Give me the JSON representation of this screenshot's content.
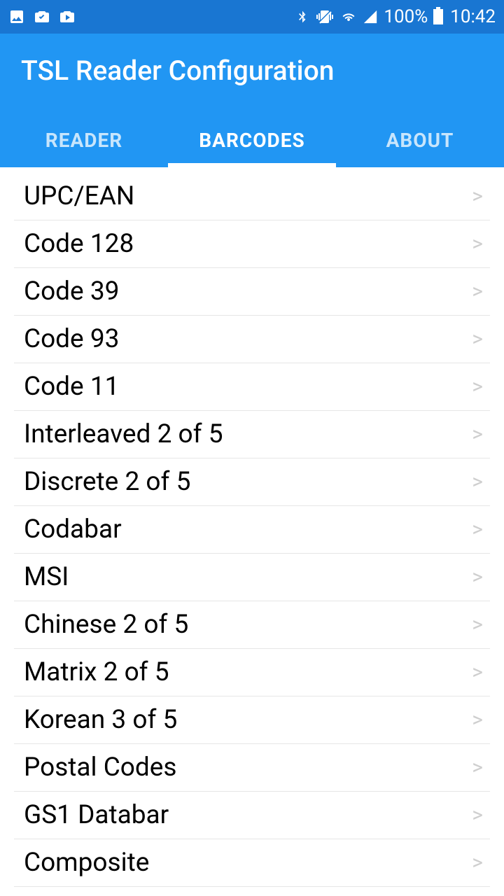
{
  "status": {
    "battery": "100%",
    "time": "10:42"
  },
  "header": {
    "title": "TSL Reader Configuration"
  },
  "tabs": [
    {
      "label": "READER",
      "active": false
    },
    {
      "label": "BARCODES",
      "active": true
    },
    {
      "label": "ABOUT",
      "active": false
    }
  ],
  "list": [
    {
      "label": "UPC/EAN"
    },
    {
      "label": "Code 128"
    },
    {
      "label": "Code 39"
    },
    {
      "label": "Code 93"
    },
    {
      "label": "Code 11"
    },
    {
      "label": "Interleaved 2 of 5"
    },
    {
      "label": "Discrete 2 of 5"
    },
    {
      "label": "Codabar"
    },
    {
      "label": "MSI"
    },
    {
      "label": "Chinese 2 of 5"
    },
    {
      "label": "Matrix 2 of 5"
    },
    {
      "label": "Korean 3 of 5"
    },
    {
      "label": "Postal Codes"
    },
    {
      "label": "GS1 Databar"
    },
    {
      "label": "Composite"
    }
  ]
}
